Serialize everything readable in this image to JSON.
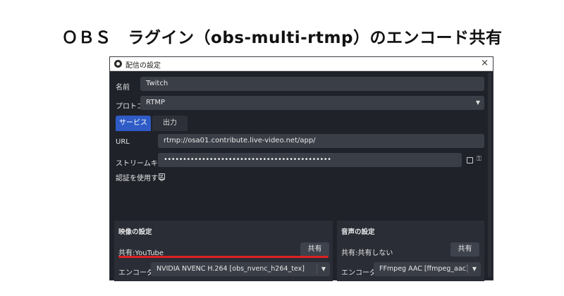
{
  "heading": "ＯＢＳ　ラグイン（obs-multi-rtmp）のエンコード共有",
  "window": {
    "title": "配信の設定",
    "close": "×"
  },
  "form": {
    "name_label": "名前",
    "name_value": "Twitch",
    "protocol_label": "プロトコル",
    "protocol_value": "RTMP",
    "tabs": [
      {
        "label": "サービス",
        "active": true
      },
      {
        "label": "出力",
        "active": false
      }
    ],
    "url_label": "URL",
    "url_value": "rtmp://osa01.contribute.live-video.net/app/",
    "key_label": "ストリームキー",
    "key_value": "••••••••••••••••••••••••••••••••••••••••••••",
    "auth_label": "認証を使用する"
  },
  "video": {
    "title": "映像の設定",
    "share_status": "共有:YouTube",
    "share_button": "共有",
    "encoder_label": "エンコーダ",
    "encoder_value": "NVIDIA NVENC H.264 [obs_nvenc_h264_tex]"
  },
  "audio": {
    "title": "音声の設定",
    "share_status": "共有:共有しない",
    "share_button": "共有",
    "encoder_label": "エンコーダ",
    "encoder_value": "FFmpeg AAC [ffmpeg_aac]"
  },
  "colors": {
    "accent_tab": "#2f5bc6",
    "highlight_line": "#e02020",
    "dialog_bg": "#1f2229"
  },
  "icons": {
    "window": "obs-logo-icon",
    "close": "close-icon",
    "dropdown": "chevron-down-icon",
    "key": "key-icon"
  }
}
